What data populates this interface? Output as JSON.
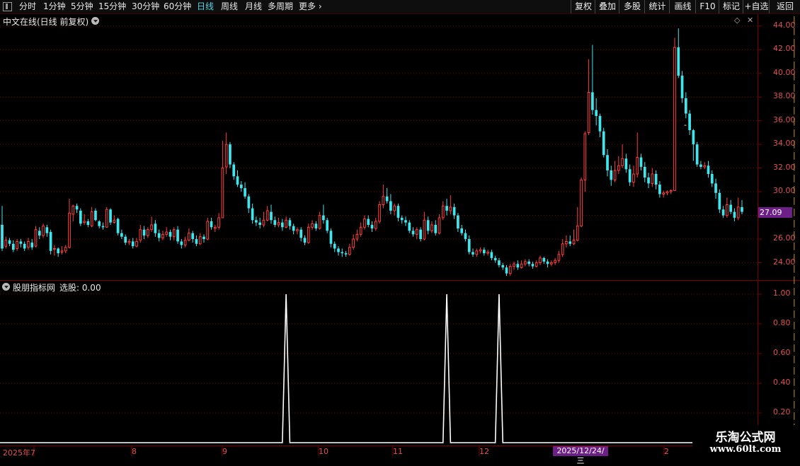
{
  "toolbar": {
    "periods": [
      "分时",
      "1分钟",
      "5分钟",
      "15分钟",
      "30分钟",
      "60分钟",
      "日线",
      "周线",
      "月线",
      "多周期",
      "更多"
    ],
    "active_period": "日线",
    "right_buttons": [
      "复权",
      "叠加",
      "多股",
      "统计",
      "画线",
      "F10",
      "标记",
      "+自选",
      "返回"
    ]
  },
  "main_panel": {
    "title": "中文在线(日线 前复权)",
    "last_price": "27.09",
    "y_ticks": [
      "44.00",
      "42.00",
      "40.00",
      "38.00",
      "36.00",
      "34.00",
      "32.00",
      "30.00",
      "26.00",
      "24.00"
    ],
    "marker": "-"
  },
  "indicator_panel": {
    "title": "股朋指标网",
    "label": "选股: 0.00",
    "y_ticks": [
      "1.00",
      "0.80",
      "0.60",
      "0.40",
      "0.20"
    ]
  },
  "x_axis": {
    "labels": [
      "2025年7",
      "8",
      "9",
      "10",
      "11",
      "12",
      "2"
    ],
    "crosshair_date": "2025/12/24/三"
  },
  "watermark": {
    "line1": "乐淘公式网",
    "line2": "www.60lt.com"
  },
  "colors": {
    "up": "#ff3d3d",
    "down": "#3ee6ee",
    "grid": "#7a0000",
    "axis_text": "#e05050",
    "signal": "#ffffff",
    "highlight": "#6c1f86"
  },
  "chart_data": [
    {
      "type": "candlestick",
      "title": "中文在线(日线 前复权)",
      "ylim": [
        22.6,
        45.0
      ],
      "y_ticks": [
        24,
        26,
        28,
        30,
        32,
        34,
        36,
        38,
        40,
        42,
        44
      ],
      "last_price": 27.09,
      "candles": [
        [
          27.2,
          25.2,
          28.8,
          25.0
        ],
        [
          25.4,
          25.9,
          26.2,
          25.2
        ],
        [
          25.9,
          25.6,
          26.1,
          25.4
        ],
        [
          25.6,
          25.1,
          25.9,
          24.9
        ],
        [
          25.2,
          25.8,
          26.0,
          25.0
        ],
        [
          25.8,
          25.6,
          26.0,
          25.3
        ],
        [
          25.6,
          25.2,
          25.8,
          25.0
        ],
        [
          25.3,
          25.8,
          26.1,
          25.1
        ],
        [
          25.7,
          25.3,
          26.0,
          25.1
        ],
        [
          25.4,
          26.8,
          27.1,
          25.3
        ],
        [
          26.7,
          26.3,
          27.0,
          26.0
        ],
        [
          26.3,
          27.1,
          27.3,
          26.1
        ],
        [
          27.0,
          26.5,
          27.2,
          26.2
        ],
        [
          26.6,
          25.0,
          26.8,
          24.7
        ],
        [
          25.2,
          25.2,
          25.5,
          24.6
        ],
        [
          25.2,
          24.8,
          25.3,
          24.5
        ],
        [
          24.9,
          25.0,
          25.4,
          24.7
        ],
        [
          25.0,
          25.3,
          25.5,
          24.8
        ],
        [
          25.3,
          28.2,
          29.4,
          25.2
        ],
        [
          28.1,
          28.8,
          28.9,
          27.5
        ],
        [
          28.8,
          28.5,
          29.0,
          28.2
        ],
        [
          28.4,
          27.3,
          28.6,
          27.1
        ],
        [
          27.4,
          27.5,
          28.1,
          27.2
        ],
        [
          27.5,
          27.2,
          27.7,
          27.0
        ],
        [
          27.1,
          28.3,
          28.7,
          27.0
        ],
        [
          28.4,
          27.6,
          28.6,
          27.5
        ],
        [
          27.5,
          27.1,
          27.6,
          26.9
        ],
        [
          27.1,
          27.0,
          27.4,
          26.8
        ],
        [
          27.0,
          28.5,
          28.7,
          27.0
        ],
        [
          28.5,
          27.4,
          28.6,
          27.2
        ],
        [
          27.4,
          27.6,
          28.0,
          27.3
        ],
        [
          27.7,
          26.5,
          27.8,
          26.3
        ],
        [
          26.5,
          26.2,
          26.8,
          26.0
        ],
        [
          26.2,
          25.7,
          26.4,
          25.5
        ],
        [
          25.7,
          25.8,
          26.0,
          25.5
        ],
        [
          25.8,
          25.4,
          26.1,
          25.2
        ],
        [
          25.4,
          25.8,
          26.1,
          25.3
        ],
        [
          25.9,
          26.8,
          27.2,
          25.7
        ],
        [
          26.8,
          26.3,
          27.1,
          26.0
        ],
        [
          26.3,
          26.8,
          27.0,
          26.1
        ],
        [
          26.8,
          27.2,
          27.9,
          26.6
        ],
        [
          27.3,
          26.5,
          27.6,
          26.2
        ],
        [
          26.5,
          26.1,
          26.8,
          25.8
        ],
        [
          26.1,
          26.4,
          26.7,
          25.9
        ],
        [
          26.4,
          26.6,
          27.0,
          26.2
        ],
        [
          26.6,
          26.2,
          26.8,
          25.9
        ],
        [
          26.2,
          26.8,
          27.0,
          25.9
        ],
        [
          26.8,
          25.8,
          27.1,
          25.6
        ],
        [
          25.8,
          25.5,
          26.0,
          25.2
        ],
        [
          25.5,
          25.9,
          26.2,
          25.3
        ],
        [
          25.9,
          26.5,
          26.9,
          25.8
        ],
        [
          26.5,
          26.0,
          26.7,
          25.7
        ],
        [
          26.0,
          25.6,
          26.3,
          25.4
        ],
        [
          25.6,
          26.2,
          26.5,
          25.5
        ],
        [
          26.2,
          26.0,
          26.4,
          25.7
        ],
        [
          26.0,
          27.5,
          27.8,
          25.9
        ],
        [
          27.5,
          27.0,
          27.8,
          26.8
        ],
        [
          26.9,
          27.0,
          27.2,
          26.6
        ],
        [
          27.0,
          27.8,
          28.2,
          26.8
        ],
        [
          27.8,
          32.0,
          34.3,
          31.0
        ],
        [
          32.1,
          34.0,
          35.0,
          31.5
        ],
        [
          34.0,
          32.3,
          34.2,
          32.0
        ],
        [
          32.3,
          31.3,
          32.5,
          31.0
        ],
        [
          31.3,
          30.6,
          31.8,
          30.4
        ],
        [
          30.6,
          30.3,
          30.9,
          30.0
        ],
        [
          30.3,
          29.6,
          30.8,
          29.4
        ],
        [
          29.6,
          28.6,
          29.8,
          28.2
        ],
        [
          28.6,
          27.6,
          29.0,
          27.3
        ],
        [
          27.6,
          27.4,
          27.9,
          27.1
        ],
        [
          27.4,
          27.2,
          27.8,
          26.9
        ],
        [
          27.2,
          27.6,
          28.3,
          27.0
        ],
        [
          27.6,
          28.4,
          28.8,
          27.5
        ],
        [
          28.3,
          27.6,
          28.9,
          27.3
        ],
        [
          27.6,
          27.2,
          27.9,
          27.0
        ],
        [
          27.2,
          27.4,
          27.8,
          27.0
        ],
        [
          27.4,
          27.0,
          27.7,
          26.7
        ],
        [
          27.0,
          27.6,
          27.9,
          26.9
        ],
        [
          27.6,
          27.1,
          27.8,
          26.8
        ],
        [
          27.1,
          26.7,
          27.3,
          26.4
        ],
        [
          26.7,
          26.8,
          27.0,
          26.4
        ],
        [
          26.8,
          26.1,
          27.0,
          25.8
        ],
        [
          26.1,
          25.7,
          26.3,
          25.5
        ],
        [
          25.7,
          27.0,
          27.3,
          25.6
        ],
        [
          27.0,
          27.3,
          27.6,
          26.8
        ],
        [
          27.3,
          26.9,
          27.5,
          26.7
        ],
        [
          26.9,
          28.0,
          28.3,
          26.8
        ],
        [
          28.0,
          27.6,
          28.9,
          27.3
        ],
        [
          27.6,
          26.7,
          27.8,
          26.5
        ],
        [
          26.7,
          25.6,
          26.9,
          25.3
        ],
        [
          25.6,
          25.2,
          25.8,
          24.9
        ],
        [
          25.2,
          24.9,
          25.4,
          24.6
        ],
        [
          24.9,
          24.8,
          25.2,
          24.5
        ],
        [
          24.8,
          24.7,
          25.0,
          24.5
        ],
        [
          24.7,
          25.3,
          25.6,
          24.6
        ],
        [
          25.3,
          26.0,
          26.4,
          25.1
        ],
        [
          26.0,
          26.4,
          26.8,
          25.8
        ],
        [
          26.4,
          27.0,
          27.4,
          26.2
        ],
        [
          27.0,
          27.7,
          28.0,
          26.8
        ],
        [
          27.7,
          27.2,
          28.0,
          27.0
        ],
        [
          27.2,
          26.9,
          27.5,
          26.6
        ],
        [
          26.9,
          27.5,
          27.8,
          26.7
        ],
        [
          27.5,
          28.9,
          29.2,
          27.3
        ],
        [
          28.9,
          29.6,
          30.6,
          28.6
        ],
        [
          29.6,
          29.2,
          30.3,
          29.0
        ],
        [
          29.2,
          28.4,
          29.8,
          28.1
        ],
        [
          28.4,
          28.8,
          29.0,
          28.0
        ],
        [
          28.8,
          27.8,
          29.0,
          27.5
        ],
        [
          27.8,
          27.6,
          28.0,
          27.3
        ],
        [
          27.6,
          27.4,
          27.9,
          27.1
        ],
        [
          27.4,
          26.7,
          27.6,
          26.5
        ],
        [
          26.7,
          26.4,
          27.0,
          26.2
        ],
        [
          26.4,
          26.8,
          27.0,
          26.0
        ],
        [
          26.8,
          26.0,
          27.0,
          25.8
        ],
        [
          26.0,
          27.6,
          28.3,
          25.9
        ],
        [
          27.6,
          26.7,
          27.9,
          26.4
        ],
        [
          26.7,
          27.2,
          27.5,
          26.5
        ],
        [
          27.2,
          26.5,
          27.6,
          26.3
        ],
        [
          26.5,
          27.8,
          28.1,
          26.4
        ],
        [
          27.8,
          28.8,
          29.2,
          27.6
        ],
        [
          28.8,
          28.4,
          29.4,
          28.0
        ],
        [
          28.4,
          28.7,
          29.7,
          28.1
        ],
        [
          28.7,
          28.0,
          29.0,
          27.7
        ],
        [
          28.0,
          26.9,
          28.2,
          26.6
        ],
        [
          26.9,
          26.5,
          27.2,
          26.3
        ],
        [
          26.5,
          26.0,
          26.8,
          25.8
        ],
        [
          26.0,
          24.9,
          26.3,
          24.7
        ],
        [
          24.9,
          24.7,
          25.2,
          24.5
        ],
        [
          24.7,
          25.0,
          25.2,
          24.5
        ],
        [
          25.0,
          25.1,
          25.3,
          24.8
        ],
        [
          25.1,
          24.8,
          25.3,
          24.6
        ],
        [
          24.8,
          24.9,
          25.1,
          24.6
        ],
        [
          24.9,
          24.4,
          25.1,
          24.2
        ],
        [
          24.4,
          24.2,
          24.6,
          24.0
        ],
        [
          24.2,
          23.8,
          24.4,
          23.6
        ],
        [
          23.8,
          23.6,
          24.0,
          23.4
        ],
        [
          23.6,
          23.1,
          23.8,
          22.9
        ],
        [
          23.1,
          23.7,
          23.9,
          22.9
        ],
        [
          23.7,
          23.9,
          24.1,
          23.4
        ],
        [
          23.9,
          23.6,
          24.2,
          23.4
        ],
        [
          23.6,
          23.9,
          24.2,
          23.5
        ],
        [
          23.9,
          24.1,
          24.3,
          23.7
        ],
        [
          24.1,
          23.9,
          24.3,
          23.7
        ],
        [
          23.9,
          23.7,
          24.1,
          23.5
        ],
        [
          23.7,
          24.0,
          24.2,
          23.6
        ],
        [
          24.0,
          24.4,
          24.6,
          23.8
        ],
        [
          24.4,
          24.1,
          24.5,
          23.9
        ],
        [
          24.1,
          23.9,
          24.3,
          23.6
        ],
        [
          23.9,
          24.0,
          24.2,
          23.7
        ],
        [
          24.0,
          24.2,
          24.4,
          23.8
        ],
        [
          24.2,
          24.7,
          25.0,
          24.0
        ],
        [
          24.7,
          25.6,
          26.0,
          24.5
        ],
        [
          25.6,
          25.8,
          26.3,
          25.3
        ],
        [
          25.8,
          25.6,
          26.3,
          25.4
        ],
        [
          25.6,
          25.9,
          26.8,
          25.5
        ],
        [
          25.9,
          27.1,
          28.7,
          25.8
        ],
        [
          27.1,
          31.0,
          31.2,
          27.0
        ],
        [
          31.0,
          34.9,
          35.1,
          30.0
        ],
        [
          35.0,
          38.4,
          41.2,
          34.8
        ],
        [
          38.4,
          36.9,
          42.4,
          36.5
        ],
        [
          36.9,
          36.4,
          37.9,
          35.6
        ],
        [
          36.4,
          35.1,
          36.6,
          34.6
        ],
        [
          35.1,
          33.1,
          35.4,
          32.9
        ],
        [
          33.1,
          31.8,
          33.6,
          31.3
        ],
        [
          31.8,
          31.0,
          32.2,
          30.5
        ],
        [
          31.0,
          31.8,
          32.6,
          30.8
        ],
        [
          31.8,
          32.2,
          33.0,
          31.5
        ],
        [
          32.2,
          32.8,
          34.0,
          32.0
        ],
        [
          32.8,
          31.9,
          33.2,
          31.6
        ],
        [
          31.9,
          30.8,
          32.3,
          30.5
        ],
        [
          30.8,
          31.5,
          32.2,
          30.4
        ],
        [
          31.5,
          32.9,
          35.0,
          31.2
        ],
        [
          32.9,
          32.1,
          33.2,
          31.8
        ],
        [
          32.1,
          31.2,
          32.5,
          30.8
        ],
        [
          31.2,
          30.7,
          31.6,
          30.3
        ],
        [
          30.7,
          31.5,
          32.0,
          30.4
        ],
        [
          31.5,
          30.6,
          31.8,
          30.2
        ],
        [
          30.6,
          29.8,
          30.9,
          29.5
        ],
        [
          29.8,
          29.9,
          30.1,
          29.5
        ],
        [
          29.9,
          30.0,
          30.1,
          29.7
        ],
        [
          30.0,
          30.1,
          30.2,
          29.8
        ],
        [
          30.1,
          42.2,
          43.0,
          38.9
        ],
        [
          42.2,
          39.8,
          43.8,
          39.6
        ],
        [
          39.8,
          37.9,
          40.2,
          37.5
        ],
        [
          37.9,
          36.6,
          38.4,
          36.2
        ],
        [
          36.6,
          35.2,
          36.9,
          34.8
        ],
        [
          35.2,
          34.0,
          35.3,
          32.6
        ],
        [
          34.0,
          32.3,
          34.2,
          32.1
        ],
        [
          32.3,
          32.1,
          32.6,
          31.9
        ],
        [
          32.1,
          32.2,
          32.5,
          31.9
        ],
        [
          32.2,
          31.5,
          32.6,
          31.2
        ],
        [
          31.5,
          30.7,
          31.8,
          30.4
        ],
        [
          30.7,
          29.9,
          31.1,
          29.4
        ],
        [
          29.9,
          28.5,
          30.2,
          28.2
        ],
        [
          28.5,
          28.0,
          28.8,
          27.8
        ],
        [
          28.0,
          28.9,
          29.5,
          27.8
        ],
        [
          28.9,
          28.3,
          29.3,
          28.1
        ],
        [
          28.3,
          27.8,
          28.6,
          27.5
        ],
        [
          27.8,
          28.7,
          29.5,
          27.6
        ],
        [
          28.7,
          28.3,
          29.3,
          28.1
        ]
      ]
    },
    {
      "type": "line",
      "title": "股朋指标网",
      "series": [
        {
          "name": "选股",
          "x_index": [
            0,
            75,
            76,
            77,
            118,
            119,
            120,
            132,
            133,
            134,
            250
          ],
          "values": [
            0,
            0,
            1,
            0,
            0,
            1,
            0,
            0,
            1,
            0,
            0
          ]
        }
      ],
      "ylim": [
        0,
        1
      ],
      "y_ticks": [
        0.2,
        0.4,
        0.6,
        0.8,
        1.0
      ]
    }
  ]
}
